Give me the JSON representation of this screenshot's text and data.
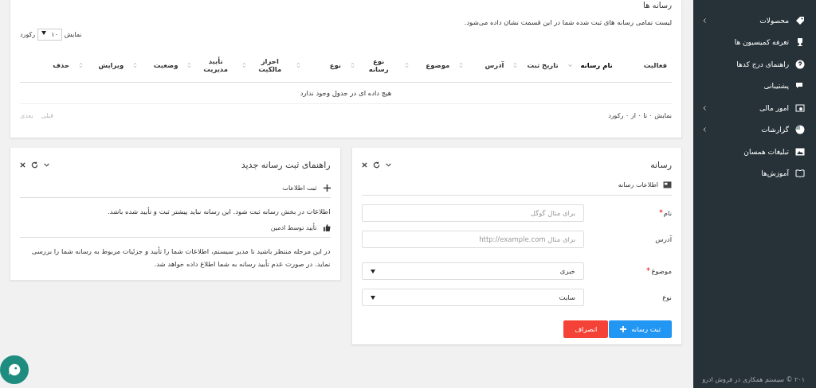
{
  "media_list": {
    "title": "رسانه ها",
    "description": "لیست تمامی رسانه های ثبت شده شما در این قسمت نشان داده می‌شود.",
    "length_menu": {
      "before": "نمایش",
      "value": "۱۰",
      "after": "رکورد"
    },
    "columns": [
      {
        "label": "فعالیت",
        "sortable": false,
        "sorted": false
      },
      {
        "label": "نام رسانه",
        "sortable": true,
        "sorted": true
      },
      {
        "label": "تاریخ ثبت",
        "sortable": true,
        "sorted": false
      },
      {
        "label": "آدرس",
        "sortable": true,
        "sorted": false
      },
      {
        "label": "موضوع",
        "sortable": true,
        "sorted": false
      },
      {
        "label": "نوع رسانه",
        "sortable": true,
        "sorted": false
      },
      {
        "label": "نوع",
        "sortable": true,
        "sorted": false
      },
      {
        "label": "احراز مالکیت",
        "sortable": true,
        "sorted": false
      },
      {
        "label": "تأیید مدیریت",
        "sortable": true,
        "sorted": false
      },
      {
        "label": "وضعیت",
        "sortable": true,
        "sorted": false
      },
      {
        "label": "ویرایش",
        "sortable": true,
        "sorted": false
      },
      {
        "label": "حذف",
        "sortable": false,
        "sorted": false
      }
    ],
    "empty_message": "هیچ داده ای در جدول وجود ندارد",
    "info": "نمایش ۰ تا ۰ از ۰ رکورد",
    "pagination": [
      {
        "label": "قبلی",
        "disabled": true
      },
      {
        "label": "بعدی",
        "disabled": true
      }
    ]
  },
  "media_form": {
    "title": "رسانه",
    "section": "اطلاعات رسانه",
    "fields": [
      {
        "label": "نام",
        "required": true,
        "kind": "input",
        "placeholder": "برای مثال گوگل"
      },
      {
        "label": "آدرس",
        "required": false,
        "kind": "input",
        "placeholder": "برای مثال http://example.com"
      },
      {
        "label": "موضوع",
        "required": true,
        "kind": "select",
        "value": "خبری"
      },
      {
        "label": "نوع",
        "required": false,
        "kind": "select",
        "value": "سایت"
      }
    ],
    "buttons": [
      {
        "label": "ثبت رسانه",
        "kind": "primary"
      },
      {
        "label": "انصراف",
        "kind": "danger"
      }
    ]
  },
  "guide": {
    "title": "راهنمای ثبت رسانه جدید",
    "steps": [
      {
        "heading": "ثبت اطلاعات",
        "text": "اطلاعات در بخش رسانه ثبت شود. این رسانه نباید پیشتر ثبت و تأیید شده باشد."
      },
      {
        "heading": "تأیید توسط ادمین",
        "text": "در این مرحله منتظر باشید تا مدیر سیستم، اطلاعات شما را تأیید و جزئیات مربوط به رسانه شما را بررسی نماید. در صورت عدم تأیید رسانه به شما اطلاع داده خواهد شد."
      }
    ]
  },
  "sidebar": {
    "items": [
      {
        "label": "محصولات",
        "submenu": true
      },
      {
        "label": "تعرفه کمیسیون ها",
        "submenu": false
      },
      {
        "label": "راهنمای درج کدها",
        "submenu": false
      },
      {
        "label": "پشتیبانی",
        "submenu": false
      },
      {
        "label": "امور مالی",
        "submenu": true
      },
      {
        "label": "گزارشات",
        "submenu": true
      },
      {
        "label": "تبلیغات همسان",
        "submenu": false
      },
      {
        "label": "آموزش‌ها",
        "submenu": false
      }
    ],
    "footer": "۲۰۱ © سیستم همکاری در فروش ادرو"
  }
}
